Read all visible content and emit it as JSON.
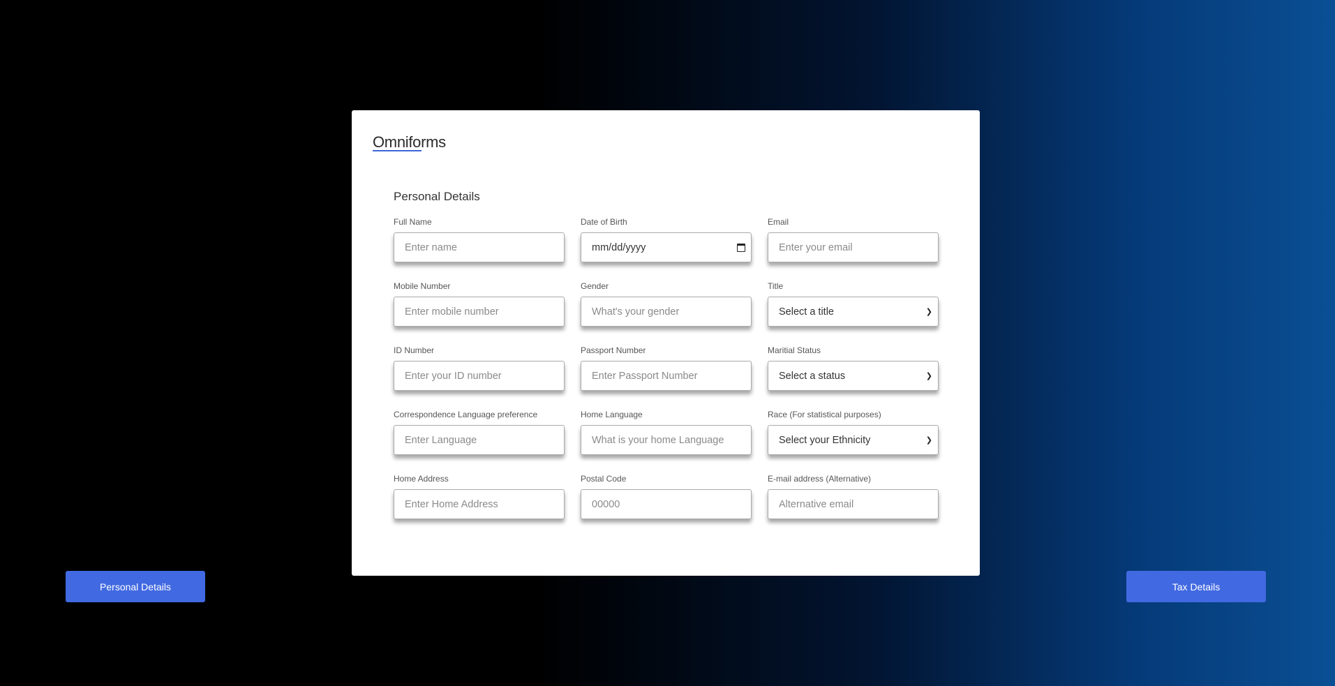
{
  "brand": {
    "name": "Omniforms"
  },
  "section": {
    "title": "Personal Details"
  },
  "fields": [
    {
      "label": "Full Name",
      "placeholder": "Enter name",
      "type": "input"
    },
    {
      "label": "Date of Birth",
      "placeholder": "mm/dd/yyyy",
      "type": "date"
    },
    {
      "label": "Email",
      "placeholder": "Enter your email",
      "type": "input"
    },
    {
      "label": "Mobile Number",
      "placeholder": "Enter mobile number",
      "type": "input"
    },
    {
      "label": "Gender",
      "placeholder": "What's your gender",
      "type": "input"
    },
    {
      "label": "Title",
      "value": "Select a title",
      "type": "select"
    },
    {
      "label": "ID Number",
      "placeholder": "Enter your ID number",
      "type": "input"
    },
    {
      "label": "Passport Number",
      "placeholder": "Enter Passport Number",
      "type": "input"
    },
    {
      "label": "Maritial Status",
      "value": "Select a status",
      "type": "select"
    },
    {
      "label": "Correspondence Language preference",
      "placeholder": "Enter Language",
      "type": "input"
    },
    {
      "label": "Home Language",
      "placeholder": "What is your home Language",
      "type": "input"
    },
    {
      "label": "Race (For statistical purposes)",
      "value": "Select your Ethnicity",
      "type": "select"
    },
    {
      "label": "Home Address",
      "placeholder": "Enter Home Address",
      "type": "input"
    },
    {
      "label": "Postal Code",
      "placeholder": "00000",
      "type": "input"
    },
    {
      "label": "E-mail address (Alternative)",
      "placeholder": "Alternative email",
      "type": "input"
    }
  ],
  "nav": {
    "prev_label": "Personal Details",
    "next_label": "Tax Details"
  }
}
